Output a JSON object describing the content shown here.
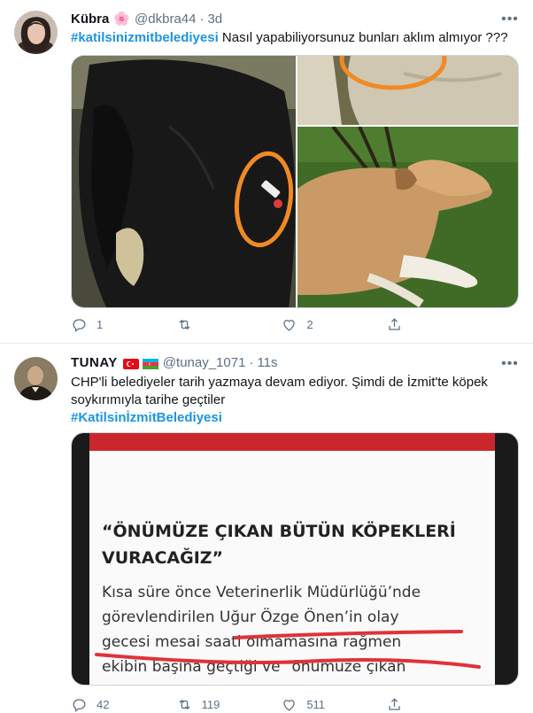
{
  "tweets": [
    {
      "display_name": "Kübra",
      "emoji": "🌸",
      "handle": "@dkbra44",
      "separator": "·",
      "time": "3d",
      "hashtag": "#katilsinizmitbelediyesi",
      "body": "Nasıl yapabiliyorsunuz bunları aklım almıyor ???",
      "reply_count": "1",
      "retweet_count": "",
      "like_count": "2"
    },
    {
      "display_name": "TUNAY",
      "handle": "@tunay_1071",
      "separator": "·",
      "time": "11s",
      "body_line1": "CHP'li belediyeler tarih yazmaya devam ediyor. Şimdi de İzmit'te köpek",
      "body_line2": "soykırımıyla tarihe geçtiler",
      "hashtag": "#KatilsinİzmitBelediyesi",
      "image_headline_1": "“ÖNÜMÜZE ÇIKAN BÜTÜN KÖPEKLERİ",
      "image_headline_2": "VURACAĞIZ”",
      "image_line_1": "Kısa süre önce Veterinerlik Müdürlüğü’nde",
      "image_line_2": "görevlendirilen Uğur Özge Önen’in olay",
      "image_line_3": "gecesi mesai saati olmamasına rağmen",
      "image_line_4": "ekibin başına geçtiği ve “önümüze çıkan",
      "reply_count": "42",
      "retweet_count": "119",
      "like_count": "511"
    }
  ],
  "colors": {
    "accent": "#1b95e0",
    "muted": "#5b7083",
    "annotation_orange": "#f08a24",
    "underline_red": "#e0323a"
  },
  "icons": [
    "reply-icon",
    "retweet-icon",
    "like-icon",
    "share-icon",
    "more-icon"
  ]
}
